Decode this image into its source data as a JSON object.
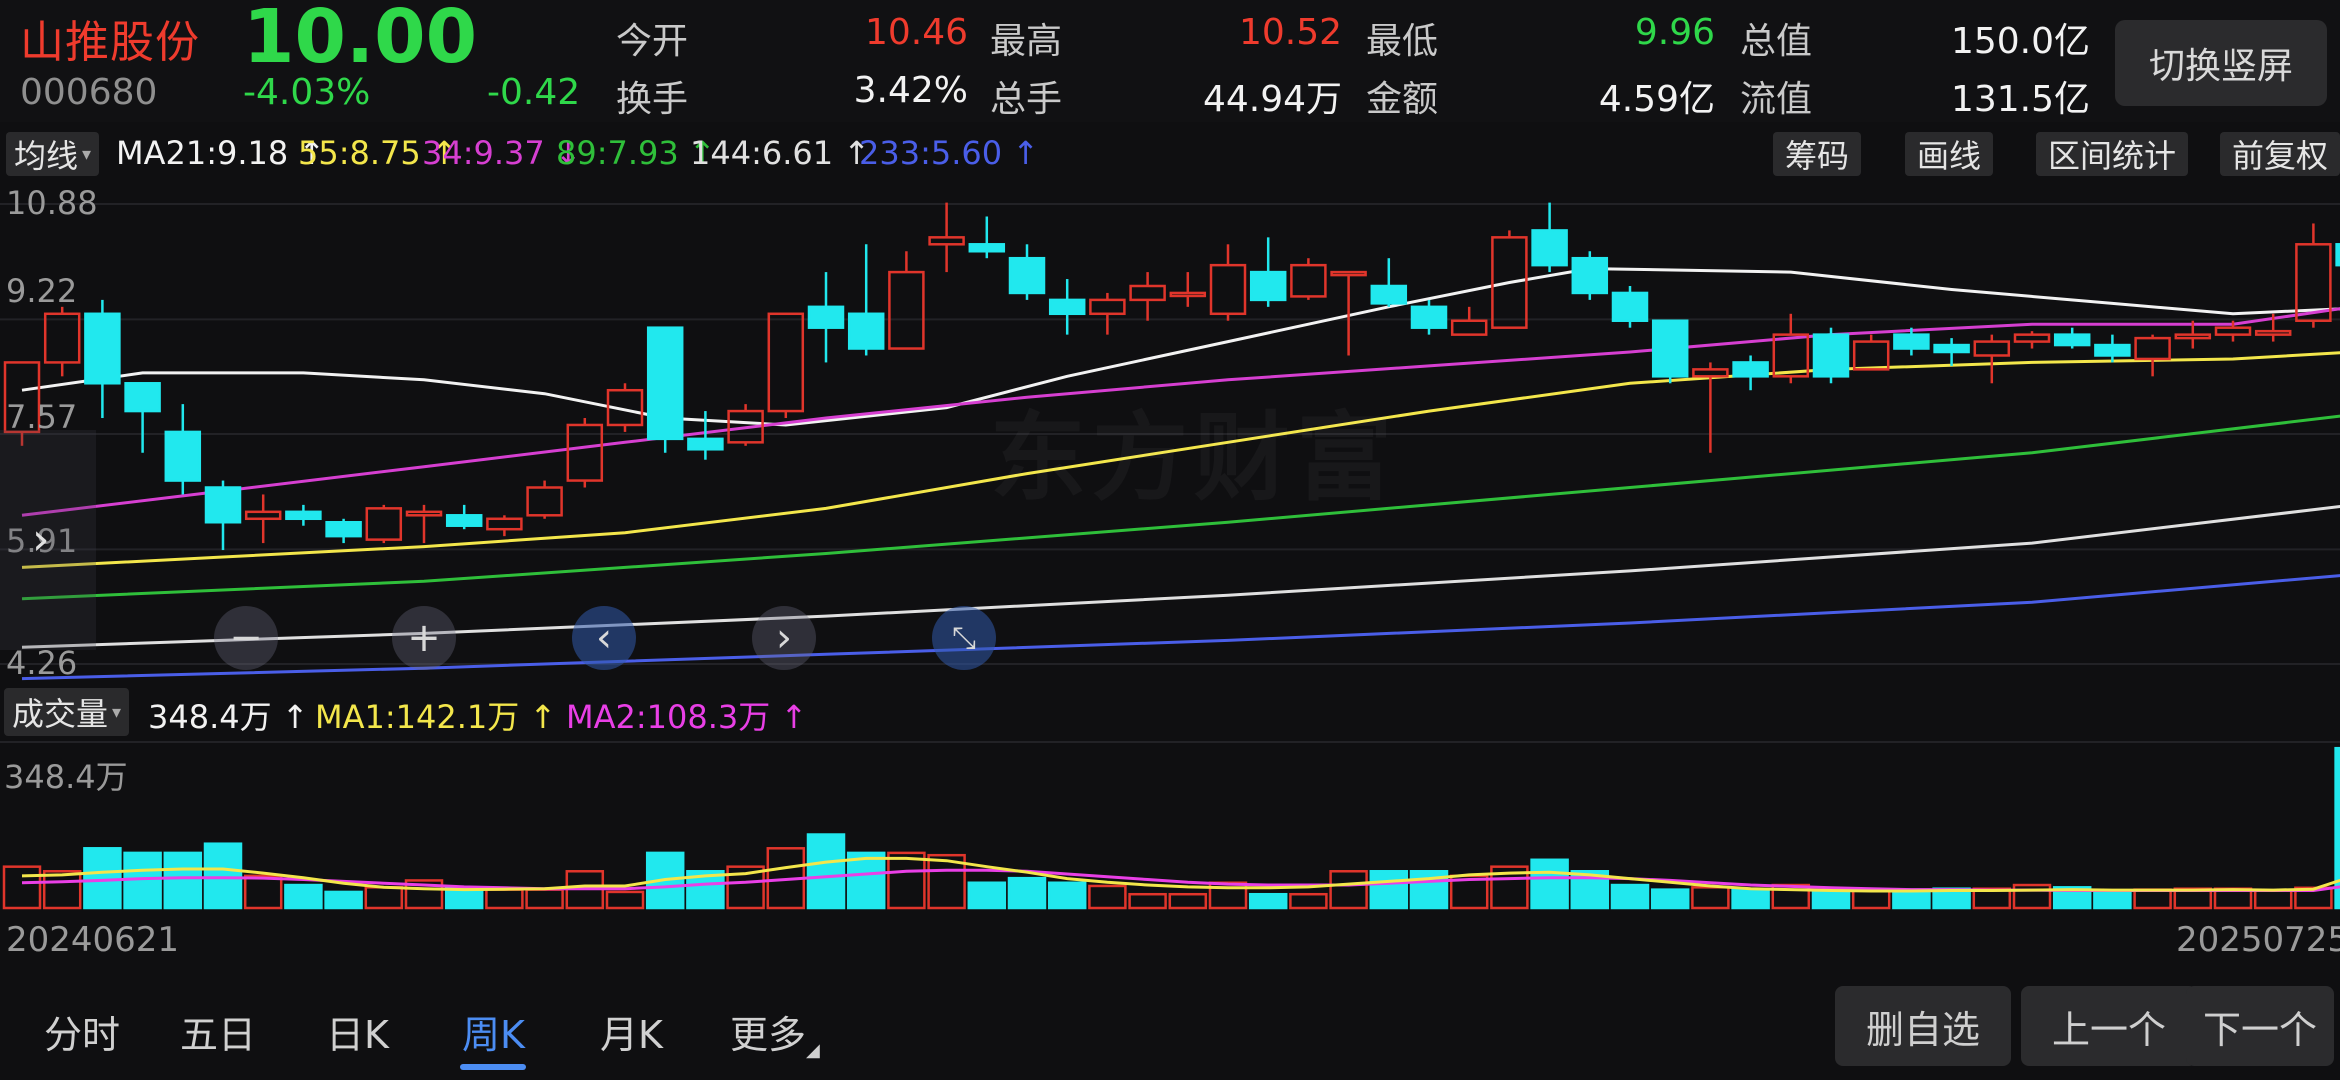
{
  "header": {
    "stock_name": "山推股份",
    "stock_code": "000680",
    "last_price": "10.00",
    "change_percent": "-4.03%",
    "change_amount": "-0.42",
    "quotes": [
      {
        "label": "今开",
        "value": "10.46",
        "color": "#ef3b2d"
      },
      {
        "label": "最高",
        "value": "10.52",
        "color": "#ef3b2d"
      },
      {
        "label": "最低",
        "value": "9.96",
        "color": "#2fd84a"
      },
      {
        "label": "总值",
        "value": "150.0亿",
        "color": "#f2f2f2"
      },
      {
        "label": "换手",
        "value": "3.42%",
        "color": "#f2f2f2"
      },
      {
        "label": "总手",
        "value": "44.94万",
        "color": "#f2f2f2"
      },
      {
        "label": "金额",
        "value": "4.59亿",
        "color": "#f2f2f2"
      },
      {
        "label": "流值",
        "value": "131.5亿",
        "color": "#f2f2f2"
      }
    ],
    "switch_button": "切换竖屏"
  },
  "ma_legend": {
    "dropdown": "均线",
    "items": [
      {
        "text": "MA21:9.18",
        "arrow": "↑",
        "color": "#f2f2f2"
      },
      {
        "text": "55:8.75",
        "arrow": "↑",
        "color": "#f3e64b"
      },
      {
        "text": "34:9.37",
        "arrow": "↓",
        "color": "#d63fd1"
      },
      {
        "text": "89:7.93",
        "arrow": "↑",
        "color": "#2fbf3a"
      },
      {
        "text": "144:6.61",
        "arrow": "↑",
        "color": "#e0e0e0"
      },
      {
        "text": "233:5.60",
        "arrow": "↑",
        "color": "#4a5ee8"
      }
    ]
  },
  "toolbar": {
    "chips": "筹码",
    "draw": "画线",
    "range_stats": "区间统计",
    "adjust": "前复权"
  },
  "price_axis": [
    "10.88",
    "9.22",
    "7.57",
    "5.91",
    "4.26"
  ],
  "watermark": "东方财富",
  "volume_legend": {
    "dropdown": "成交量",
    "value": "348.4万",
    "value_arrow": "↑",
    "ma1": "MA1:142.1万",
    "ma1_arrow": "↑",
    "ma2": "MA2:108.3万",
    "ma2_arrow": "↑",
    "axis_max": "348.4万"
  },
  "dates": {
    "start": "20240621",
    "end": "20250725"
  },
  "tabs": [
    {
      "label": "分时",
      "active": false
    },
    {
      "label": "五日",
      "active": false
    },
    {
      "label": "日K",
      "active": false
    },
    {
      "label": "周K",
      "active": true
    },
    {
      "label": "月K",
      "active": false
    },
    {
      "label": "更多",
      "active": false
    }
  ],
  "buttons": {
    "remove_watchlist": "删自选",
    "previous": "上一个",
    "next": "下一个"
  },
  "colors": {
    "up": "#e0352b",
    "down": "#21e8ee",
    "ma21": "#f2f2f2",
    "ma34": "#d63fd1",
    "ma55": "#f3e64b",
    "ma89": "#2fbf3a",
    "ma144": "#e0e0e0",
    "ma233": "#4a5ee8"
  },
  "chart_data": {
    "type": "candlestick",
    "price_range": [
      4.26,
      11.2
    ],
    "candles": [
      {
        "o": 7.6,
        "h": 8.6,
        "l": 7.4,
        "c": 8.6
      },
      {
        "o": 8.6,
        "h": 9.4,
        "l": 8.4,
        "c": 9.3
      },
      {
        "o": 9.3,
        "h": 9.5,
        "l": 7.8,
        "c": 8.3
      },
      {
        "o": 8.3,
        "h": 8.3,
        "l": 7.3,
        "c": 7.9
      },
      {
        "o": 7.6,
        "h": 8.0,
        "l": 6.7,
        "c": 6.9
      },
      {
        "o": 6.8,
        "h": 6.9,
        "l": 5.9,
        "c": 6.3
      },
      {
        "o": 6.35,
        "h": 6.7,
        "l": 6.0,
        "c": 6.45
      },
      {
        "o": 6.45,
        "h": 6.55,
        "l": 6.25,
        "c": 6.35
      },
      {
        "o": 6.3,
        "h": 6.35,
        "l": 6.0,
        "c": 6.1
      },
      {
        "o": 6.05,
        "h": 6.55,
        "l": 6.0,
        "c": 6.5
      },
      {
        "o": 6.4,
        "h": 6.55,
        "l": 6.0,
        "c": 6.45
      },
      {
        "o": 6.4,
        "h": 6.55,
        "l": 6.2,
        "c": 6.25
      },
      {
        "o": 6.2,
        "h": 6.4,
        "l": 6.1,
        "c": 6.35
      },
      {
        "o": 6.4,
        "h": 6.9,
        "l": 6.35,
        "c": 6.8
      },
      {
        "o": 6.9,
        "h": 7.8,
        "l": 6.8,
        "c": 7.7
      },
      {
        "o": 7.7,
        "h": 8.3,
        "l": 7.6,
        "c": 8.2
      },
      {
        "o": 9.1,
        "h": 9.1,
        "l": 7.3,
        "c": 7.5
      },
      {
        "o": 7.5,
        "h": 7.9,
        "l": 7.2,
        "c": 7.35
      },
      {
        "o": 7.45,
        "h": 8.0,
        "l": 7.4,
        "c": 7.9
      },
      {
        "o": 7.9,
        "h": 9.3,
        "l": 7.8,
        "c": 9.3
      },
      {
        "o": 9.4,
        "h": 9.9,
        "l": 8.6,
        "c": 9.1
      },
      {
        "o": 9.3,
        "h": 10.3,
        "l": 8.7,
        "c": 8.8
      },
      {
        "o": 8.8,
        "h": 10.2,
        "l": 8.8,
        "c": 9.9
      },
      {
        "o": 10.3,
        "h": 10.9,
        "l": 9.9,
        "c": 10.4
      },
      {
        "o": 10.3,
        "h": 10.7,
        "l": 10.1,
        "c": 10.2
      },
      {
        "o": 10.1,
        "h": 10.3,
        "l": 9.5,
        "c": 9.6
      },
      {
        "o": 9.5,
        "h": 9.8,
        "l": 9.0,
        "c": 9.3
      },
      {
        "o": 9.3,
        "h": 9.6,
        "l": 9.0,
        "c": 9.5
      },
      {
        "o": 9.5,
        "h": 9.9,
        "l": 9.2,
        "c": 9.7
      },
      {
        "o": 9.6,
        "h": 9.9,
        "l": 9.4,
        "c": 9.6
      },
      {
        "o": 9.3,
        "h": 10.3,
        "l": 9.2,
        "c": 10.0
      },
      {
        "o": 9.9,
        "h": 10.4,
        "l": 9.4,
        "c": 9.5
      },
      {
        "o": 9.55,
        "h": 10.1,
        "l": 9.5,
        "c": 10.0
      },
      {
        "o": 9.9,
        "h": 9.9,
        "l": 8.7,
        "c": 9.9
      },
      {
        "o": 9.7,
        "h": 10.1,
        "l": 9.4,
        "c": 9.45
      },
      {
        "o": 9.4,
        "h": 9.5,
        "l": 9.0,
        "c": 9.1
      },
      {
        "o": 9.0,
        "h": 9.4,
        "l": 9.0,
        "c": 9.2
      },
      {
        "o": 9.1,
        "h": 10.5,
        "l": 9.1,
        "c": 10.4
      },
      {
        "o": 10.5,
        "h": 10.9,
        "l": 9.9,
        "c": 10.0
      },
      {
        "o": 10.1,
        "h": 10.2,
        "l": 9.5,
        "c": 9.6
      },
      {
        "o": 9.6,
        "h": 9.7,
        "l": 9.1,
        "c": 9.2
      },
      {
        "o": 9.2,
        "h": 9.2,
        "l": 8.3,
        "c": 8.4
      },
      {
        "o": 8.4,
        "h": 8.6,
        "l": 7.3,
        "c": 8.5
      },
      {
        "o": 8.6,
        "h": 8.7,
        "l": 8.2,
        "c": 8.4
      },
      {
        "o": 8.4,
        "h": 9.3,
        "l": 8.3,
        "c": 9.0
      },
      {
        "o": 9.0,
        "h": 9.1,
        "l": 8.3,
        "c": 8.4
      },
      {
        "o": 8.5,
        "h": 9.0,
        "l": 8.5,
        "c": 8.9
      },
      {
        "o": 9.0,
        "h": 9.1,
        "l": 8.7,
        "c": 8.8
      },
      {
        "o": 8.85,
        "h": 8.95,
        "l": 8.55,
        "c": 8.75
      },
      {
        "o": 8.7,
        "h": 9.0,
        "l": 8.3,
        "c": 8.9
      },
      {
        "o": 8.9,
        "h": 9.05,
        "l": 8.8,
        "c": 9.0
      },
      {
        "o": 9.0,
        "h": 9.1,
        "l": 8.8,
        "c": 8.85
      },
      {
        "o": 8.85,
        "h": 9.0,
        "l": 8.6,
        "c": 8.7
      },
      {
        "o": 8.65,
        "h": 9.0,
        "l": 8.4,
        "c": 8.95
      },
      {
        "o": 8.95,
        "h": 9.2,
        "l": 8.8,
        "c": 9.0
      },
      {
        "o": 9.0,
        "h": 9.2,
        "l": 8.9,
        "c": 9.1
      },
      {
        "o": 9.0,
        "h": 9.3,
        "l": 8.9,
        "c": 9.05
      },
      {
        "o": 9.2,
        "h": 10.6,
        "l": 9.1,
        "c": 10.3
      },
      {
        "o": 10.3,
        "h": 11.1,
        "l": 9.9,
        "c": 10.0
      }
    ],
    "ma": {
      "MA21": [
        [
          0,
          8.2
        ],
        [
          3,
          8.45
        ],
        [
          7,
          8.45
        ],
        [
          10,
          8.35
        ],
        [
          13,
          8.15
        ],
        [
          16,
          7.8
        ],
        [
          19,
          7.7
        ],
        [
          23,
          7.95
        ],
        [
          26,
          8.4
        ],
        [
          30,
          8.9
        ],
        [
          34,
          9.4
        ],
        [
          37,
          9.75
        ],
        [
          39,
          9.95
        ],
        [
          44,
          9.9
        ],
        [
          48,
          9.65
        ],
        [
          52,
          9.45
        ],
        [
          55,
          9.3
        ],
        [
          58,
          9.38
        ]
      ],
      "MA34": [
        [
          0,
          6.4
        ],
        [
          5,
          6.75
        ],
        [
          10,
          7.1
        ],
        [
          15,
          7.45
        ],
        [
          20,
          7.8
        ],
        [
          25,
          8.1
        ],
        [
          30,
          8.35
        ],
        [
          35,
          8.55
        ],
        [
          40,
          8.75
        ],
        [
          45,
          9.0
        ],
        [
          50,
          9.15
        ],
        [
          55,
          9.15
        ],
        [
          58,
          9.4
        ]
      ],
      "MA55": [
        [
          0,
          5.65
        ],
        [
          5,
          5.8
        ],
        [
          10,
          5.95
        ],
        [
          15,
          6.15
        ],
        [
          20,
          6.5
        ],
        [
          25,
          7.0
        ],
        [
          30,
          7.45
        ],
        [
          35,
          7.9
        ],
        [
          40,
          8.3
        ],
        [
          45,
          8.5
        ],
        [
          50,
          8.6
        ],
        [
          55,
          8.65
        ],
        [
          58,
          8.75
        ]
      ],
      "MA89": [
        [
          0,
          5.2
        ],
        [
          10,
          5.45
        ],
        [
          20,
          5.85
        ],
        [
          30,
          6.3
        ],
        [
          40,
          6.8
        ],
        [
          50,
          7.3
        ],
        [
          58,
          7.85
        ]
      ],
      "MA144": [
        [
          0,
          4.5
        ],
        [
          10,
          4.7
        ],
        [
          20,
          4.95
        ],
        [
          30,
          5.25
        ],
        [
          40,
          5.6
        ],
        [
          50,
          6.0
        ],
        [
          58,
          6.55
        ]
      ],
      "MA233": [
        [
          0,
          4.05
        ],
        [
          10,
          4.2
        ],
        [
          20,
          4.4
        ],
        [
          30,
          4.6
        ],
        [
          40,
          4.85
        ],
        [
          50,
          5.15
        ],
        [
          58,
          5.55
        ]
      ]
    },
    "volume_max": 348.4,
    "volumes": [
      90,
      80,
      130,
      120,
      120,
      140,
      70,
      50,
      35,
      45,
      60,
      45,
      40,
      40,
      80,
      35,
      120,
      80,
      90,
      130,
      160,
      120,
      120,
      115,
      55,
      65,
      55,
      48,
      30,
      30,
      55,
      30,
      30,
      80,
      80,
      80,
      70,
      90,
      105,
      80,
      50,
      40,
      45,
      40,
      50,
      35,
      40,
      40,
      42,
      42,
      50,
      45,
      38,
      40,
      42,
      42,
      38,
      44,
      348
    ],
    "volume_ma1": [
      70,
      72,
      78,
      82,
      85,
      85,
      76,
      66,
      54,
      45,
      42,
      40,
      41,
      42,
      48,
      48,
      62,
      70,
      75,
      88,
      100,
      108,
      108,
      103,
      90,
      78,
      64,
      56,
      50,
      46,
      44,
      44,
      46,
      52,
      58,
      64,
      72,
      76,
      78,
      72,
      64,
      56,
      48,
      42,
      40,
      38,
      37,
      37,
      38,
      38,
      39,
      40,
      39,
      39,
      39,
      40,
      39,
      41,
      70
    ],
    "volume_ma2": [
      55,
      57,
      60,
      64,
      66,
      66,
      65,
      62,
      58,
      54,
      50,
      46,
      44,
      42,
      42,
      42,
      46,
      52,
      56,
      62,
      68,
      74,
      80,
      82,
      82,
      80,
      74,
      68,
      62,
      56,
      52,
      50,
      50,
      50,
      54,
      58,
      62,
      64,
      66,
      66,
      64,
      60,
      55,
      50,
      47,
      44,
      42,
      40,
      40,
      39,
      39,
      38,
      38,
      38,
      38,
      38,
      38,
      38,
      50
    ]
  }
}
